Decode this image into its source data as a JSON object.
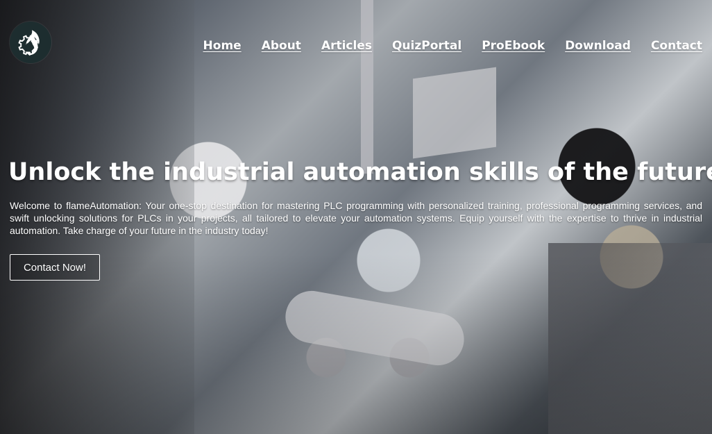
{
  "header": {
    "logo_icon": "flame-gear-icon",
    "nav": [
      {
        "label": "Home"
      },
      {
        "label": "About"
      },
      {
        "label": "Articles"
      },
      {
        "label": "QuizPortal"
      },
      {
        "label": "ProEbook"
      },
      {
        "label": "Download"
      },
      {
        "label": "Contact"
      }
    ]
  },
  "hero": {
    "title": "Unlock the industrial automation skills of the future",
    "description": "Welcome to flameAutomation: Your one-stop destination for mastering PLC programming with personalized training, professional programming services, and swift unlocking solutions for PLCs in your projects, all tailored to elevate your automation systems. Equip yourself with the expertise to thrive in industrial automation. Take charge of your future in the industry today!",
    "cta_label": "Contact Now!"
  },
  "colors": {
    "logo_background": "#1d2d2f",
    "text": "#ffffff"
  }
}
